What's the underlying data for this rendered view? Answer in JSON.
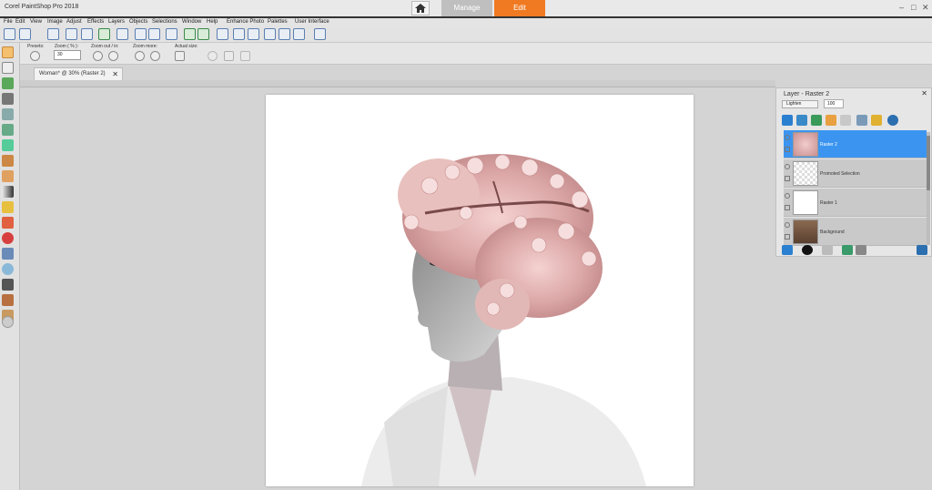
{
  "window": {
    "title": "Corel PaintShop Pro 2018",
    "home_icon": "home-icon",
    "tabs": [
      {
        "label": "Manage"
      },
      {
        "label": "Edit",
        "active": true
      }
    ],
    "controls": {
      "minimize": "–",
      "maximize": "□",
      "close": "✕"
    }
  },
  "menu": {
    "items": [
      "File",
      "Edit",
      "View",
      "Image",
      "Adjust",
      "Effects",
      "Layers",
      "Objects",
      "Selections",
      "Window",
      "Help",
      "Enhance Photo",
      "Palettes",
      "User Interface"
    ]
  },
  "tool_options": {
    "presets_label": "Presets:",
    "zoom_label": "Zoom ( % ):",
    "zoom_value": "30",
    "zoom_out_in_label": "Zoom out / in:",
    "zoom_more_label": "Zoom more:",
    "actual_size_label": "Actual size:"
  },
  "document": {
    "tab_label": "Woman* @ 30% (Raster 2)",
    "close_glyph": "✕"
  },
  "layers": {
    "title": "Layer - Raster 2",
    "close_glyph": "✕",
    "blend_mode": "Lighten",
    "opacity": "100",
    "items": [
      {
        "name": "Raster 2",
        "selected": true
      },
      {
        "name": "Promoted Selection"
      },
      {
        "name": "Raster 1"
      },
      {
        "name": "Background"
      }
    ]
  },
  "colors": {
    "edit_tab": "#f07a22",
    "selected_layer": "#3b95f0",
    "workspace": "#d4d4d4"
  }
}
